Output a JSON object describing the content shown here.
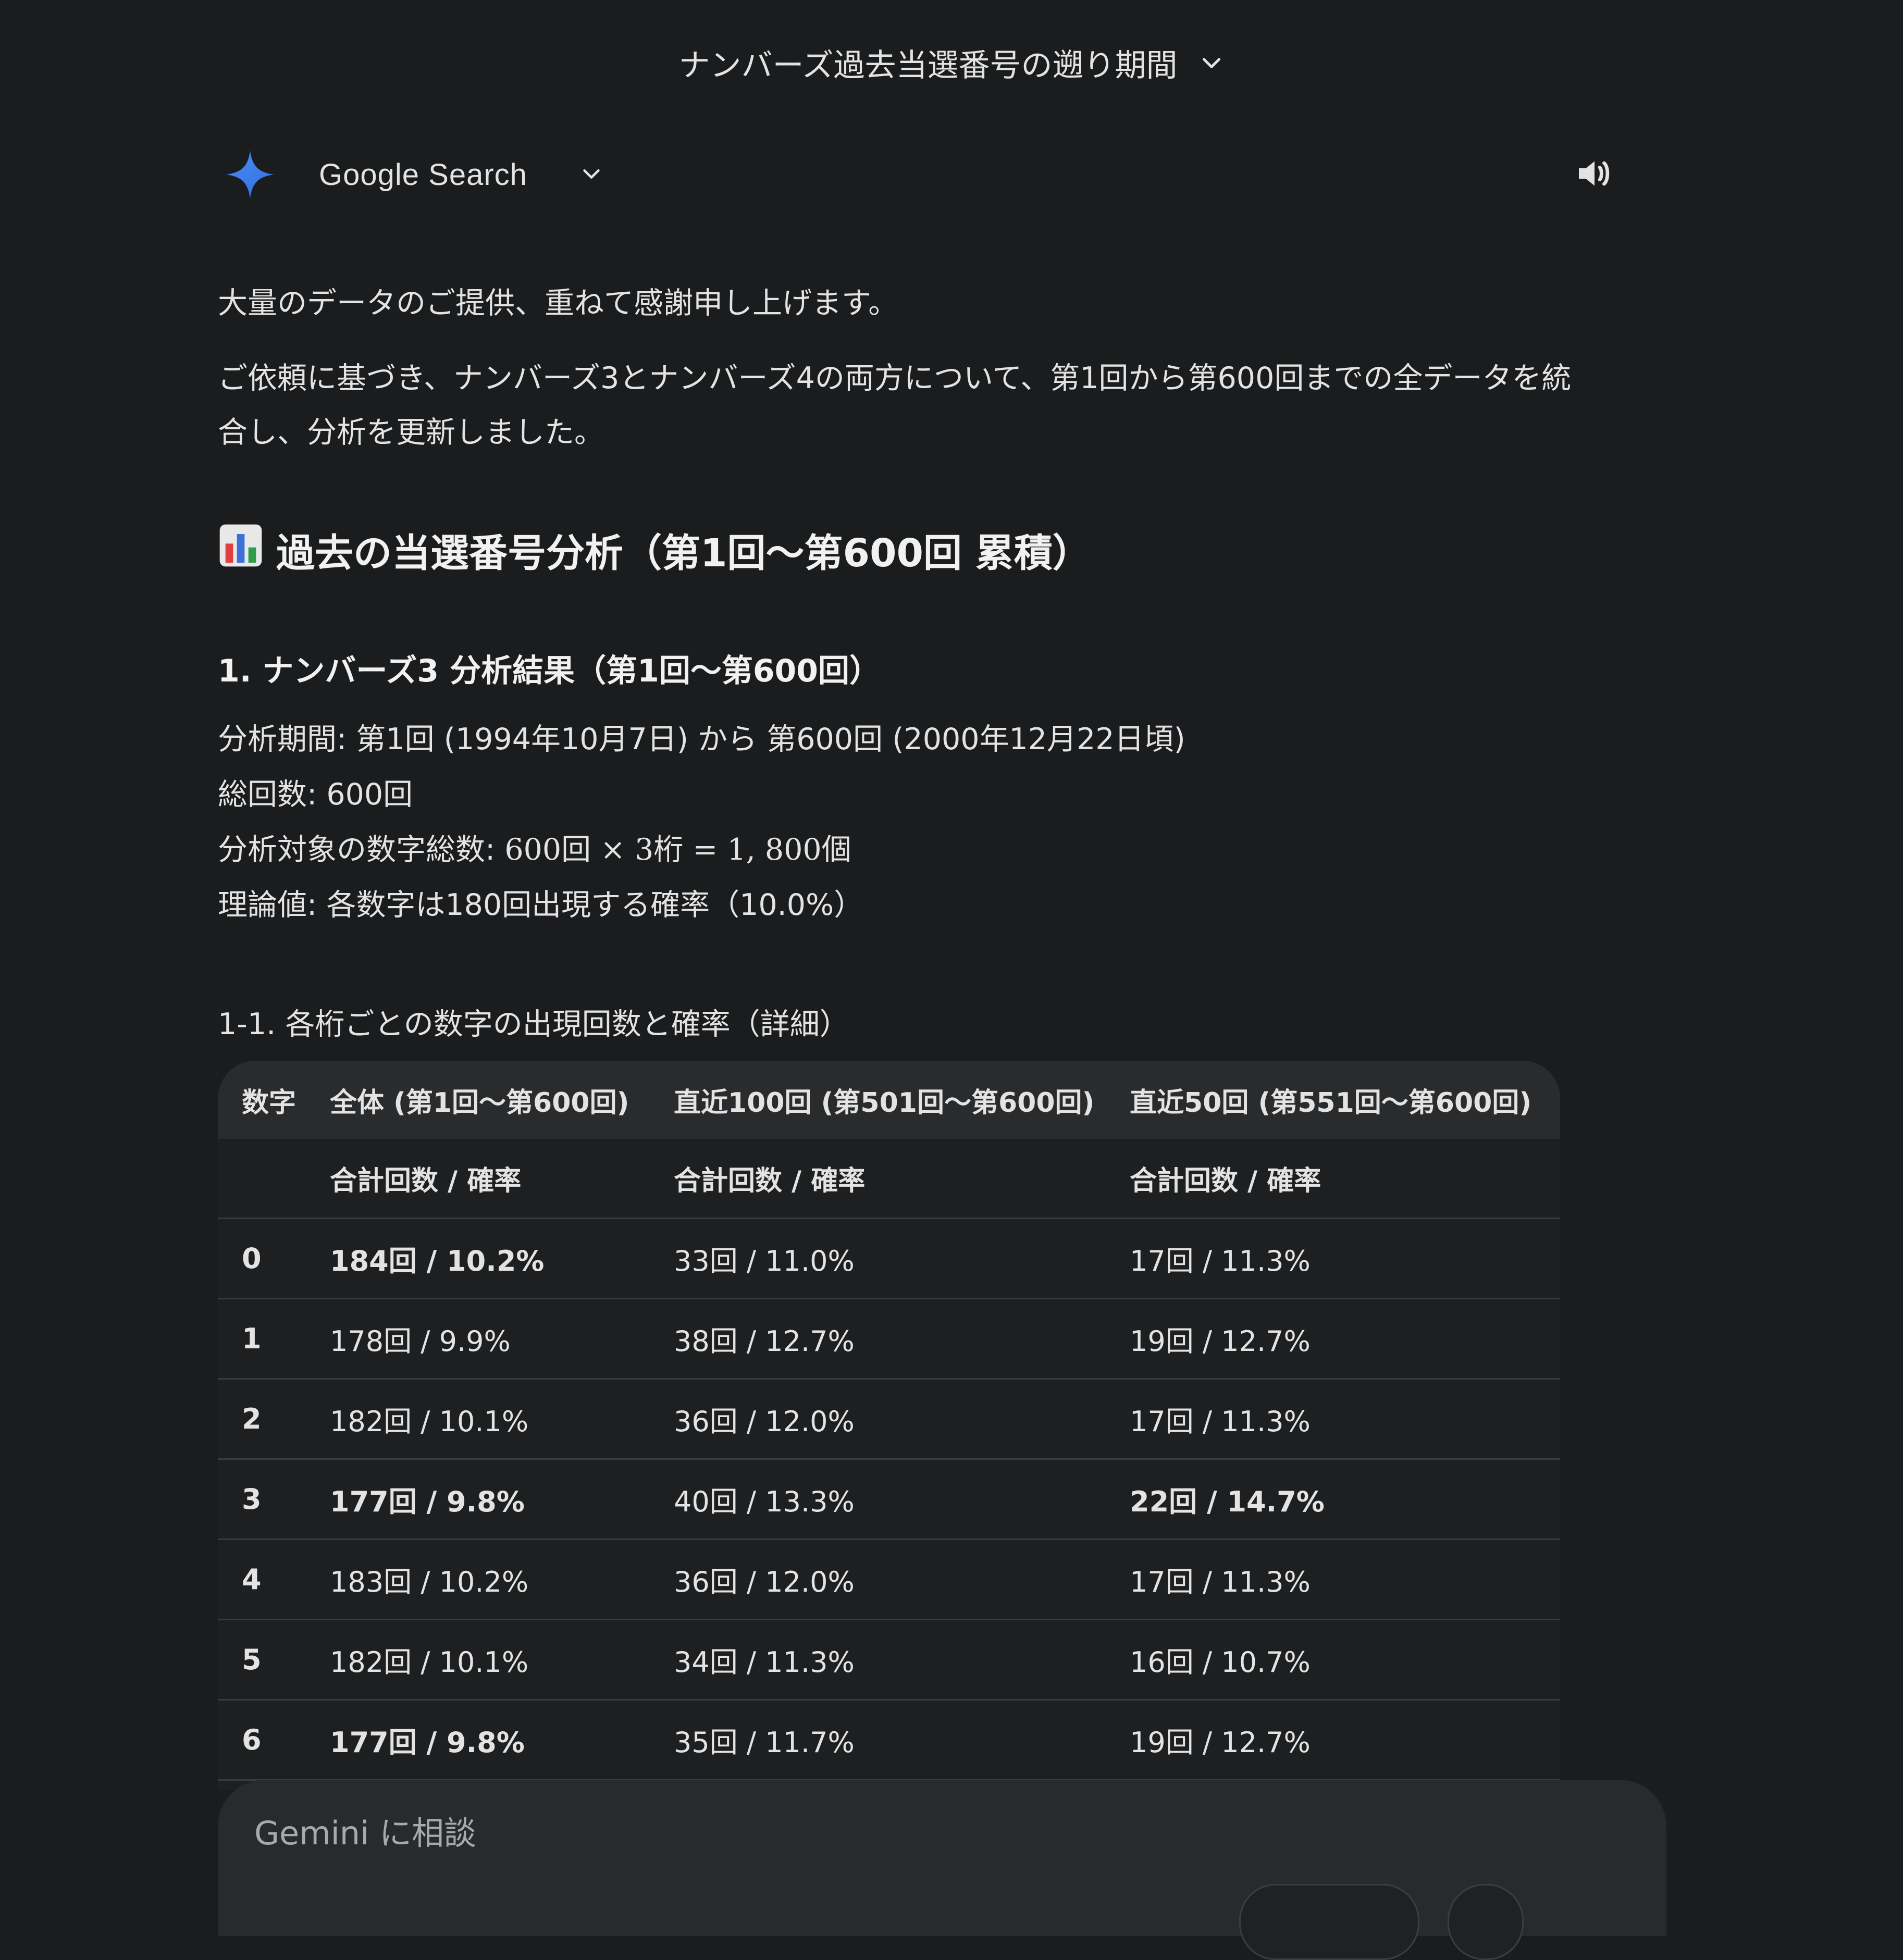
{
  "header": {
    "title": "ナンバーズ過去当選番号の遡り期間"
  },
  "source": {
    "label": "Google Search"
  },
  "content": {
    "intro": "大量のデータのご提供、重ねて感謝申し上げます。",
    "body_line1": "ご依頼に基づき、ナンバーズ3とナンバーズ4の両方について、第1回から第600回までの全データを統",
    "body_line2": "合し、分析を更新しました。",
    "section_icon": "bar-chart-emoji",
    "section_title": "過去の当選番号分析（第1回〜第600回 累積）",
    "subsection_title": "1. ナンバーズ3 分析結果（第1回〜第600回）",
    "period_line": "分析期間: 第1回 (1994年10月7日) から 第600回 (2000年12月22日頃)",
    "total_line": "総回数: 600回",
    "count_label": "分析対象の数字総数: ",
    "count_formula": "600回 × 3桁 = 1, 800個",
    "theory_line": "理論値: 各数字は180回出現する確率（10.0%）",
    "table_heading": "1-1. 各桁ごとの数字の出現回数と確率（詳細）"
  },
  "table": {
    "headers": [
      "数字",
      "全体 (第1回〜第600回)",
      "直近100回 (第501回〜第600回)",
      "直近50回 (第551回〜第600回)"
    ],
    "subheaders": [
      "",
      "合計回数 / 確率",
      "合計回数 / 確率",
      "合計回数 / 確率"
    ],
    "rows": [
      [
        "0",
        "184回 / 10.2%",
        "33回 / 11.0%",
        "17回 / 11.3%"
      ],
      [
        "1",
        "178回 / 9.9%",
        "38回 / 12.7%",
        "19回 / 12.7%"
      ],
      [
        "2",
        "182回 / 10.1%",
        "36回 / 12.0%",
        "17回 / 11.3%"
      ],
      [
        "3",
        "177回 / 9.8%",
        "40回 / 13.3%",
        "22回 / 14.7%"
      ],
      [
        "4",
        "183回 / 10.2%",
        "36回 / 12.0%",
        "17回 / 11.3%"
      ],
      [
        "5",
        "182回 / 10.1%",
        "34回 / 11.3%",
        "16回 / 10.7%"
      ],
      [
        "6",
        "177回 / 9.8%",
        "35回 / 11.7%",
        "19回 / 12.7%"
      ]
    ]
  },
  "input": {
    "placeholder": "Gemini に相談"
  },
  "colors": {
    "background": "#1b1c1d",
    "text": "#e3e3e3",
    "table_header": "#2a2b2d",
    "input_bg": "#282a2c",
    "sparkle_blue": "#4285f4"
  }
}
